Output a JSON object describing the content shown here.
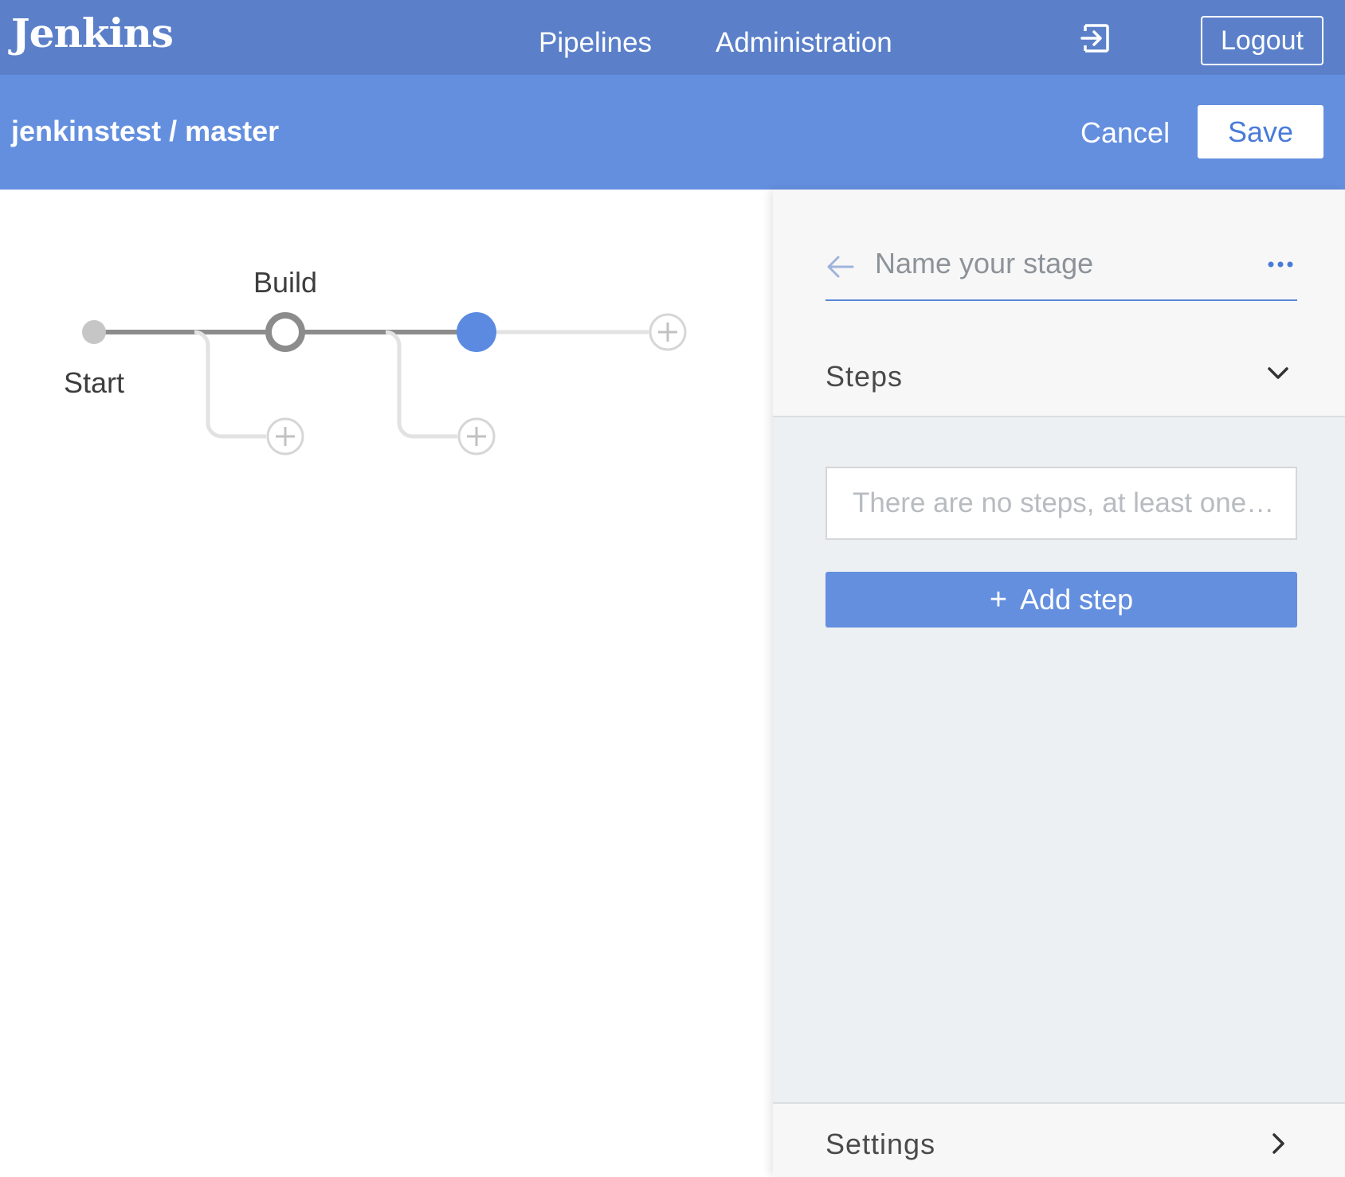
{
  "header": {
    "logo": "Jenkins",
    "nav": [
      {
        "label": "Pipelines"
      },
      {
        "label": "Administration"
      }
    ],
    "exit_icon": "sign-in-icon",
    "logout_label": "Logout"
  },
  "subheader": {
    "breadcrumb": "jenkinstest / master",
    "cancel_label": "Cancel",
    "save_label": "Save"
  },
  "pipeline": {
    "stages": [
      {
        "label": "Start",
        "state": "start"
      },
      {
        "label": "Build",
        "state": "normal"
      },
      {
        "label": "",
        "state": "selected"
      }
    ],
    "colors": {
      "selected": "#5b8ae0",
      "line": "#8c8c8c",
      "ghost": "#e2e2e2",
      "start": "#c6c6c6"
    }
  },
  "panel": {
    "stage_name_placeholder": "Name your stage",
    "stage_name_value": "",
    "steps_title": "Steps",
    "empty_message": "There are no steps, at least one…",
    "add_step_label": "Add step",
    "settings_title": "Settings"
  },
  "colors": {
    "topbar": "#5b80c9",
    "subbar": "#648fdf",
    "accent": "#648fdf"
  }
}
